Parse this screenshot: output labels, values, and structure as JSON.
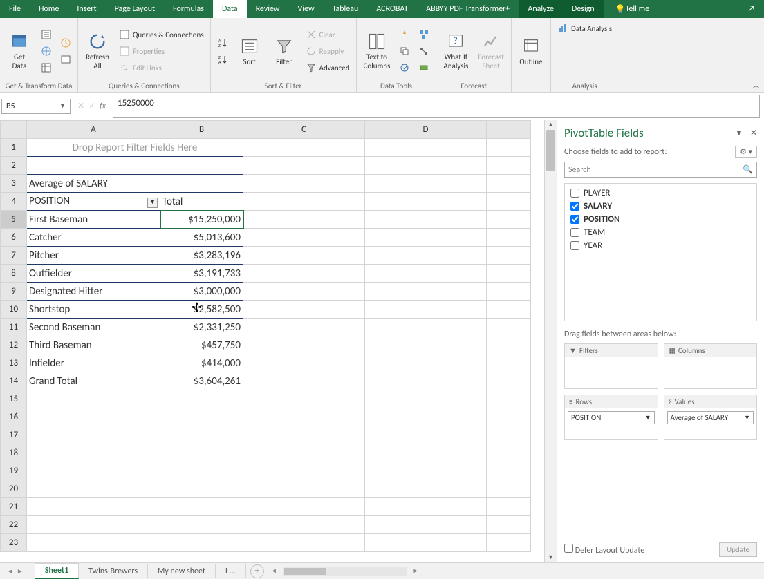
{
  "tabs": {
    "file": "File",
    "home": "Home",
    "insert": "Insert",
    "page_layout": "Page Layout",
    "formulas": "Formulas",
    "data": "Data",
    "review": "Review",
    "view": "View",
    "tableau": "Tableau",
    "acrobat": "ACROBAT",
    "abbyy": "ABBYY PDF Transformer+",
    "analyze": "Analyze",
    "design": "Design",
    "tellme": "Tell me"
  },
  "ribbon": {
    "get_data": "Get\nData",
    "get_transform": "Get & Transform Data",
    "refresh": "Refresh\nAll",
    "queries": "Queries & Connections",
    "properties": "Properties",
    "edit_links": "Edit Links",
    "queries_group": "Queries & Connections",
    "sort": "Sort",
    "filter": "Filter",
    "clear": "Clear",
    "reapply": "Reapply",
    "advanced": "Advanced",
    "sort_filter": "Sort & Filter",
    "text_cols": "Text to\nColumns",
    "data_tools": "Data Tools",
    "whatif": "What-If\nAnalysis",
    "forecast_sheet": "Forecast\nSheet",
    "forecast": "Forecast",
    "outline": "Outline",
    "data_analysis": "Data Analysis",
    "analysis": "Analysis"
  },
  "name_box": "B5",
  "formula": "15250000",
  "columns": [
    "A",
    "B",
    "C",
    "D"
  ],
  "pivot": {
    "drop_filter": "Drop Report Filter Fields Here",
    "avg_label": "Average of SALARY",
    "position_label": "POSITION",
    "total_label": "Total",
    "rows": [
      {
        "pos": "First Baseman",
        "val": "$15,250,000"
      },
      {
        "pos": "Catcher",
        "val": "$5,013,600"
      },
      {
        "pos": "Pitcher",
        "val": "$3,283,196"
      },
      {
        "pos": "Outfielder",
        "val": "$3,191,733"
      },
      {
        "pos": "Designated Hitter",
        "val": "$3,000,000"
      },
      {
        "pos": "Shortstop",
        "val": "$2,582,500"
      },
      {
        "pos": "Second Baseman",
        "val": "$2,331,250"
      },
      {
        "pos": "Third Baseman",
        "val": "$457,750"
      },
      {
        "pos": "Infielder",
        "val": "$414,000"
      }
    ],
    "grand_total_label": "Grand Total",
    "grand_total_val": "$3,604,261"
  },
  "pane": {
    "title": "PivotTable Fields",
    "choose": "Choose fields to add to report:",
    "search": "Search",
    "fields": [
      {
        "name": "PLAYER",
        "checked": false
      },
      {
        "name": "SALARY",
        "checked": true
      },
      {
        "name": "POSITION",
        "checked": true
      },
      {
        "name": "TEAM",
        "checked": false
      },
      {
        "name": "YEAR",
        "checked": false
      }
    ],
    "drag": "Drag fields between areas below:",
    "filters": "Filters",
    "columns": "Columns",
    "rows_label": "Rows",
    "values": "Values",
    "row_item": "POSITION",
    "value_item": "Average of SALARY",
    "defer": "Defer Layout Update",
    "update": "Update"
  },
  "sheets": {
    "s1": "Sheet1",
    "s2": "Twins-Brewers",
    "s3": "My new sheet",
    "s4": "I ..."
  }
}
